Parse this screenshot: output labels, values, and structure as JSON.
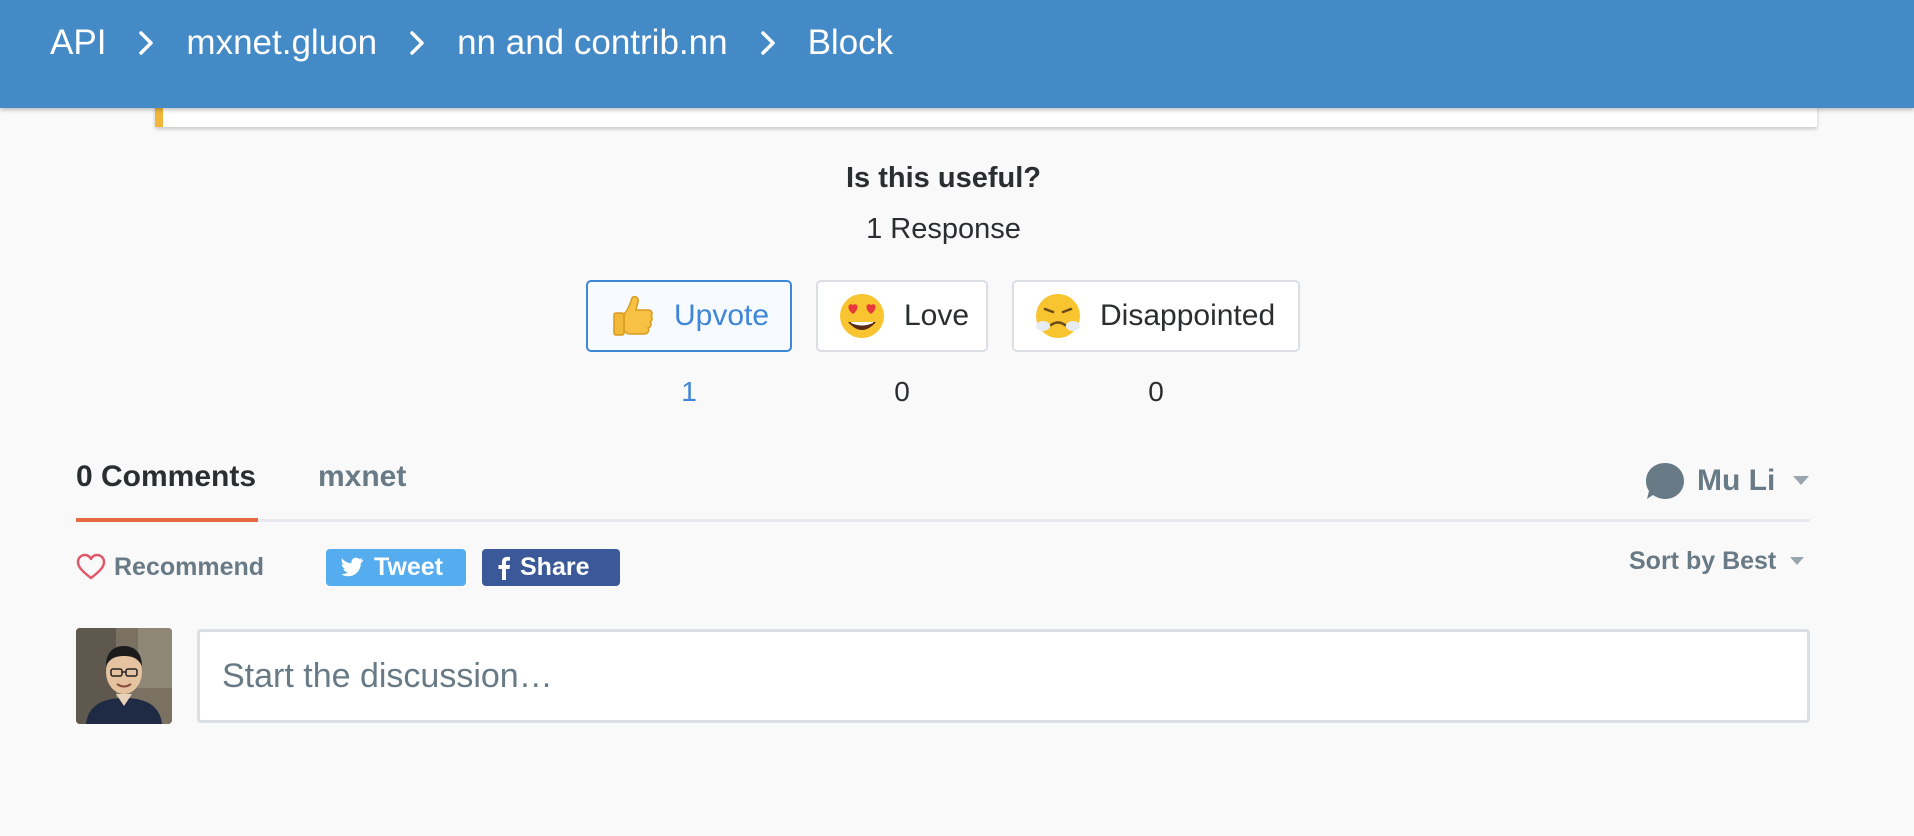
{
  "breadcrumb": {
    "items": [
      "API",
      "mxnet.gluon",
      "nn and contrib.nn",
      "Block"
    ]
  },
  "reactions": {
    "title": "Is this useful?",
    "response_count": "1 Response",
    "buttons": [
      {
        "label": "Upvote",
        "count": "1",
        "icon": "thumbs-up-icon",
        "selected": true
      },
      {
        "label": "Love",
        "count": "0",
        "icon": "heart-eyes-icon",
        "selected": false
      },
      {
        "label": "Disappointed",
        "count": "0",
        "icon": "disappointed-face-icon",
        "selected": false
      }
    ]
  },
  "comments": {
    "tabs": [
      "0 Comments",
      "mxnet"
    ],
    "user_name": "Mu Li",
    "recommend_label": "Recommend",
    "tweet_label": "Tweet",
    "share_label": "Share",
    "sort_label": "Sort by Best",
    "composer_placeholder": "Start the discussion…"
  },
  "colors": {
    "header": "#448ac6",
    "accent_blue": "#3e86d7",
    "tab_underline": "#e86b3f",
    "twitter": "#55acee",
    "facebook": "#3b5998",
    "note_border": "#f0b73b"
  }
}
